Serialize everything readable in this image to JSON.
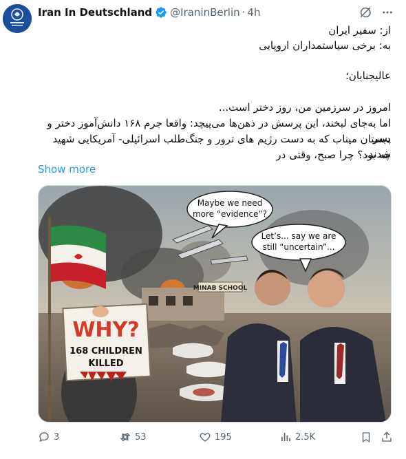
{
  "tweet": {
    "author_name": "Iran In Deutschland",
    "handle": "@IraninBerlin",
    "separator": "·",
    "time": "4h",
    "lines": [
      "از: سفیر ایران",
      "به: برخی سیاستمداران اروپایی",
      "عالیجنابان؛",
      "امروز در سرزمین من، روز دختر است...",
      "اما به‌جای لبخند، این پرسش در ذهن‌ها می‌پیچد: واقعا جرم ۱۶۸ دانش‌آموز دختر و پسر",
      "دبستان میناب که به دست رژیم های ترور و جنگ‌طلب اسرائیلی- آمریکایی شهید شدند،",
      "چه بود؟ چرا صبح، وقتی در"
    ],
    "show_more": "Show more"
  },
  "image": {
    "bubble_left": [
      "Maybe we need",
      "more “evidence”?"
    ],
    "bubble_right": [
      "Let’s... say we are",
      "still “uncertain”..."
    ],
    "school_sign": "MINAB SCHOOL",
    "sign_why": "WHY?",
    "sign_line1": "168 CHILDREN",
    "sign_line2": "KILLED"
  },
  "actions": {
    "replies": "3",
    "reposts": "53",
    "likes": "195",
    "views": "2.5K"
  },
  "icons": [
    "grok-icon",
    "more-icon",
    "reply-icon",
    "repost-icon",
    "like-icon",
    "views-icon",
    "bookmark-icon",
    "share-icon",
    "verified-badge-icon"
  ],
  "colors": {
    "link": "#1d9bf0",
    "secondary_text": "#536471",
    "verified": "#1d9bf0"
  }
}
